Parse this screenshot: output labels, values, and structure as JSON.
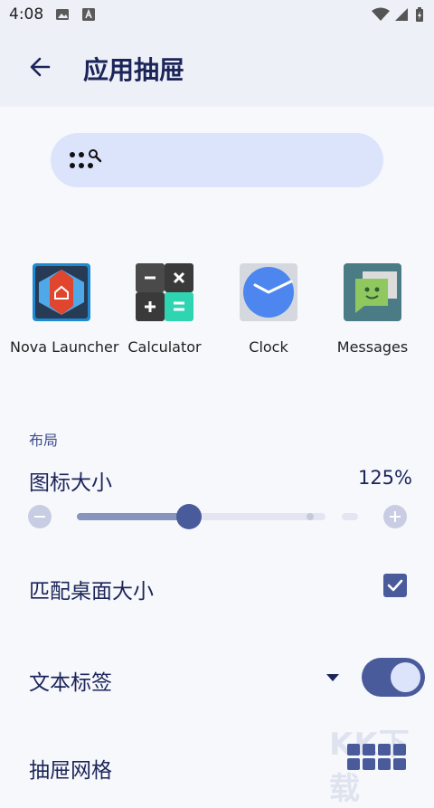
{
  "status_bar": {
    "time": "4:08",
    "icons": [
      "image-icon",
      "a-icon",
      "wifi-icon",
      "signal-icon",
      "battery-icon"
    ]
  },
  "app_bar": {
    "title": "应用抽屉",
    "back_icon": "arrow-left-icon"
  },
  "search": {
    "icon": "dots-search-icon"
  },
  "apps": [
    {
      "label": "Nova Launcher",
      "icon": "nova-launcher-icon"
    },
    {
      "label": "Calculator",
      "icon": "calculator-icon"
    },
    {
      "label": "Clock",
      "icon": "clock-icon"
    },
    {
      "label": "Messages",
      "icon": "messages-icon"
    }
  ],
  "layout_section": {
    "label": "布局",
    "icon_size": {
      "label": "图标大小",
      "value_text": "125%",
      "slider_fraction": 0.45
    },
    "match_desktop": {
      "label": "匹配桌面大小",
      "checked": true
    },
    "text_labels": {
      "label": "文本标签",
      "enabled": true
    },
    "drawer_grid": {
      "label": "抽屉网格"
    }
  },
  "watermark": {
    "text": "KK下载"
  },
  "colors": {
    "accent": "#4a5b9c",
    "search_bg": "#dce4fb",
    "header_bg": "#eef0f7",
    "title_text": "#1b2559"
  }
}
